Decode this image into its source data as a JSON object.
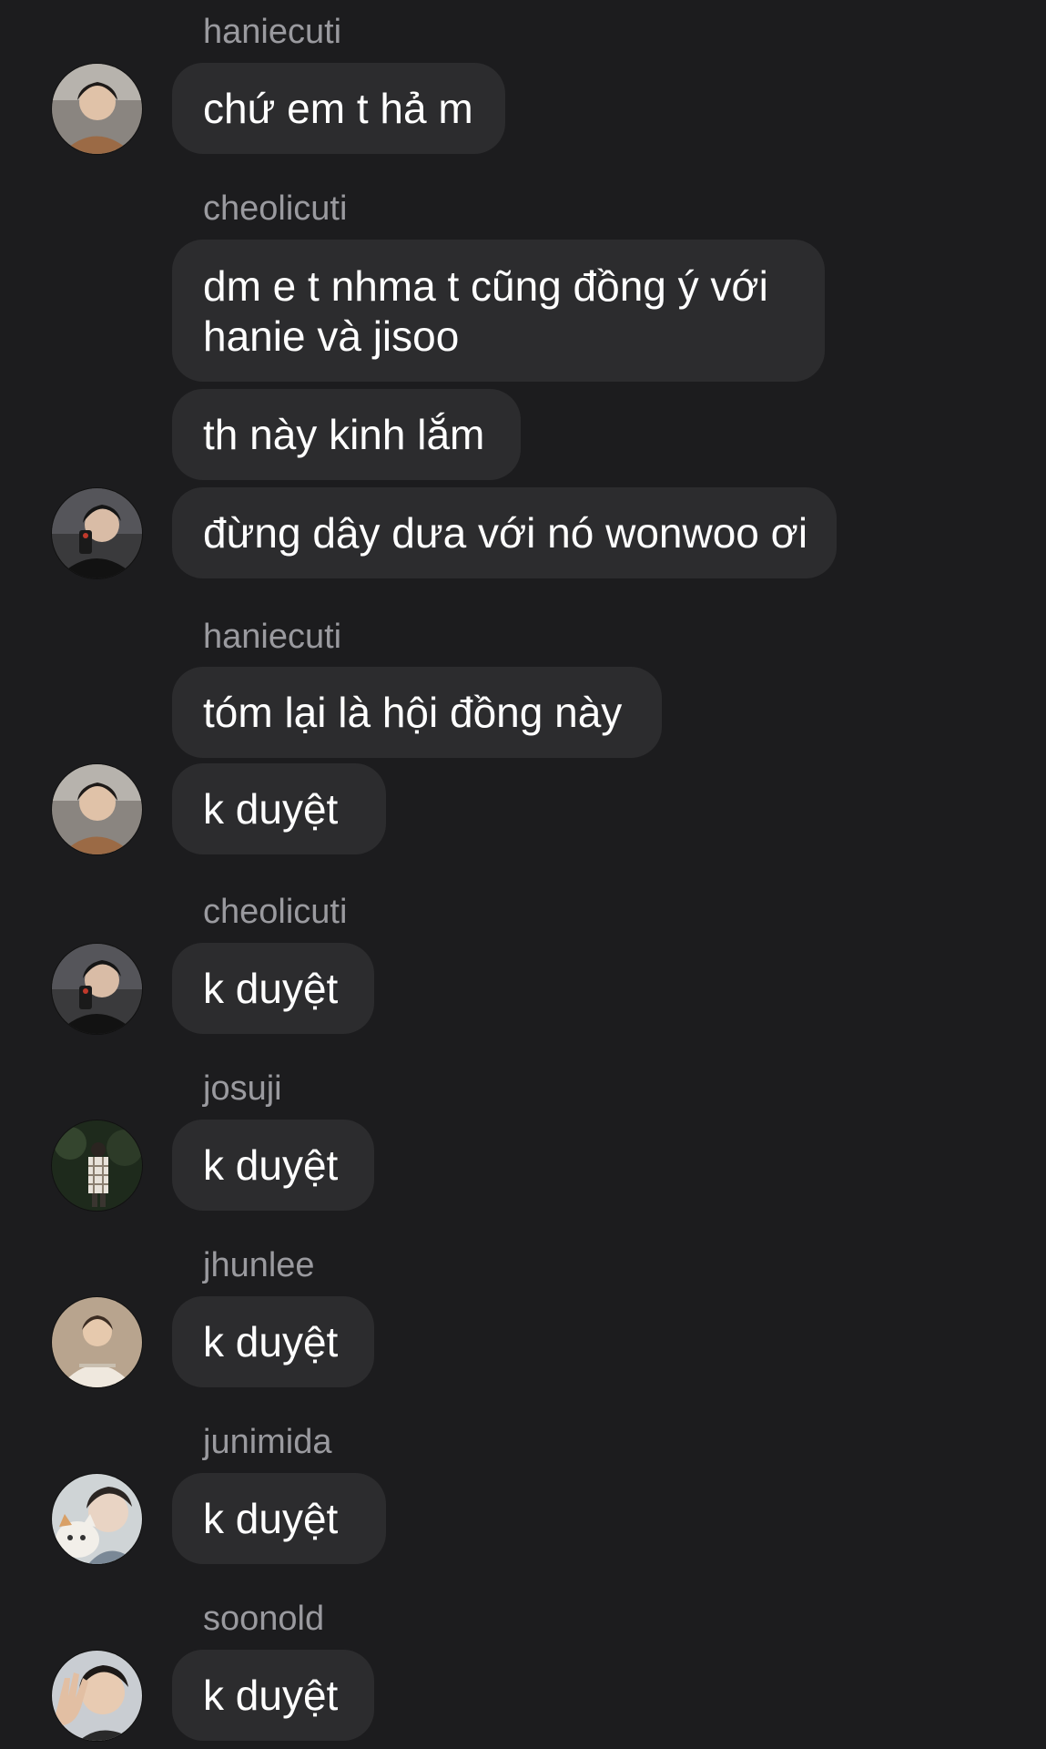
{
  "messages": [
    {
      "sender": "haniecuti",
      "bubbles": [
        "chứ em t hả m"
      ]
    },
    {
      "sender": "cheolicuti",
      "bubbles": [
        "dm e t nhma t cũng đồng ý với hanie và jisoo",
        "th này kinh lắm",
        "đừng dây dưa với nó wonwoo ơi"
      ]
    },
    {
      "sender": "haniecuti",
      "bubbles": [
        "tóm lại là hội đồng này",
        "k duyệt"
      ]
    },
    {
      "sender": "cheolicuti",
      "bubbles": [
        "k duyệt"
      ]
    },
    {
      "sender": "josuji",
      "bubbles": [
        "k duyệt"
      ]
    },
    {
      "sender": "jhunlee",
      "bubbles": [
        "k duyệt"
      ]
    },
    {
      "sender": "junimida",
      "bubbles": [
        "k duyệt"
      ]
    },
    {
      "sender": "soonold",
      "bubbles": [
        "k duyệt"
      ]
    }
  ],
  "colors": {
    "background": "#1c1c1e",
    "bubble": "#2c2c2e",
    "sender_text": "#9a9a9f",
    "message_text": "#ffffff"
  }
}
